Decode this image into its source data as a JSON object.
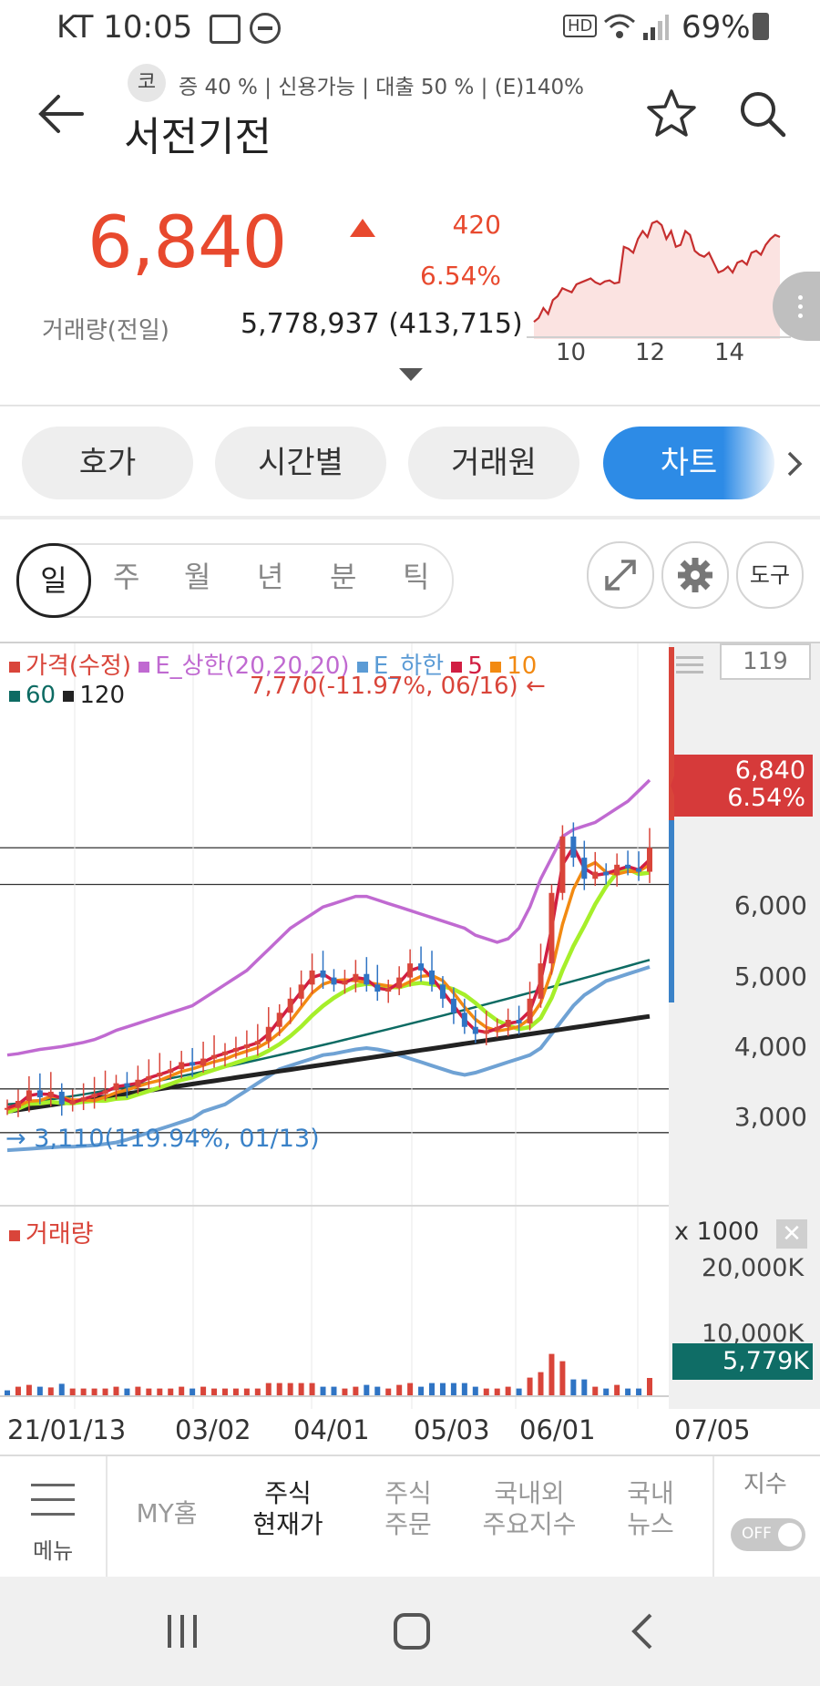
{
  "status": {
    "carrier_time": "KT 10:05",
    "battery": "69%"
  },
  "header": {
    "badge": "코",
    "info_line": "증 40 % | 신용가능 | 대출 50 % | (E)140%",
    "title": "서전기전"
  },
  "quote": {
    "price": "6,840",
    "change": "420",
    "change_pct": "6.54%",
    "volume_label": "거래량(전일)",
    "volume_value": "5,778,937 (413,715)",
    "mini_ticks": [
      "10",
      "12",
      "14"
    ],
    "mini_series": [
      20,
      24,
      34,
      28,
      42,
      46,
      54,
      52,
      50,
      58,
      60,
      62,
      64,
      60,
      58,
      61,
      62,
      59,
      60,
      96,
      94,
      90,
      104,
      112,
      106,
      120,
      122,
      118,
      104,
      112,
      96,
      98,
      112,
      108,
      92,
      88,
      86,
      90,
      80,
      70,
      72,
      76,
      70,
      80,
      82,
      78,
      90,
      92,
      88,
      98,
      104,
      108,
      106
    ],
    "up_color": "#e8492e"
  },
  "tabs": [
    "호가",
    "시간별",
    "거래원",
    "차트"
  ],
  "active_tab": "차트",
  "periods": [
    "일",
    "주",
    "월",
    "년",
    "분",
    "틱"
  ],
  "active_period": "일",
  "tools": {
    "expand_icon": "expand-arrows-icon",
    "settings_icon": "gear-icon",
    "tool_label": "도구"
  },
  "chart": {
    "legend_row1": [
      {
        "label": "가격(수정)",
        "color": "#d9453a"
      },
      {
        "label": "E_상한(20,20,20)",
        "color": "#c06ad1"
      },
      {
        "label": "E_하한",
        "color": "#5b9bd5"
      },
      {
        "label": "5",
        "color": "#d11e42"
      },
      {
        "label": "10",
        "color": "#f28a12"
      }
    ],
    "legend_row2": [
      {
        "label": "60",
        "color": "#0d6b63"
      },
      {
        "label": "120",
        "color": "#222222"
      }
    ],
    "high_note": "7,770(-11.97%, 06/16) ←",
    "low_note": "→ 3,110(119.94%, 01/13)",
    "period_count": "119",
    "price_tag": "6,840",
    "price_tag_pct": "6.54%",
    "volume_title": "거래량",
    "volume_scale": "x 1000",
    "volume_tag": "5,779K",
    "volume_axis": [
      "20,000K",
      "10,000K"
    ],
    "x_labels": [
      "21/01/13",
      "03/02",
      "04/01",
      "05/03",
      "06/01",
      "07/05"
    ]
  },
  "chart_data": {
    "type": "line",
    "x_labels": [
      "21/01/13",
      "03/02",
      "04/01",
      "05/03",
      "06/01",
      "07/05"
    ],
    "y_ticks": [
      3000,
      4000,
      5000,
      6000
    ],
    "ylim": [
      2500,
      8000
    ],
    "series": [
      {
        "name": "가격(수정)",
        "color": "#d9453a",
        "values": [
          3150,
          3250,
          3400,
          3300,
          3380,
          3200,
          3250,
          3300,
          3350,
          3400,
          3500,
          3450,
          3550,
          3600,
          3650,
          3700,
          3800,
          3750,
          3850,
          3900,
          3950,
          4000,
          4050,
          4100,
          4300,
          4500,
          4700,
          4900,
          5100,
          5000,
          4900,
          4950,
          5050,
          4900,
          4800,
          4850,
          5000,
          5200,
          5100,
          4900,
          4700,
          4500,
          4300,
          4200,
          4250,
          4300,
          4400,
          4350,
          4700,
          5200,
          6200,
          7000,
          6700,
          6400,
          6500,
          6450,
          6600,
          6550,
          6500,
          6840
        ]
      },
      {
        "name": "E_상한(20,20,20)",
        "color": "#c06ad1",
        "values": [
          3900,
          3920,
          3950,
          3980,
          4000,
          4020,
          4050,
          4080,
          4120,
          4180,
          4250,
          4300,
          4350,
          4400,
          4450,
          4500,
          4550,
          4600,
          4700,
          4800,
          4900,
          5000,
          5100,
          5250,
          5400,
          5550,
          5700,
          5800,
          5900,
          6000,
          6050,
          6100,
          6150,
          6150,
          6100,
          6050,
          6000,
          5950,
          5900,
          5850,
          5800,
          5750,
          5700,
          5600,
          5550,
          5500,
          5550,
          5700,
          6000,
          6400,
          6700,
          7000,
          7100,
          7150,
          7200,
          7300,
          7400,
          7500,
          7650,
          7800
        ]
      },
      {
        "name": "E_하한",
        "color": "#5b9bd5",
        "values": [
          2550,
          2560,
          2570,
          2580,
          2590,
          2600,
          2600,
          2610,
          2620,
          2640,
          2660,
          2700,
          2750,
          2800,
          2850,
          2900,
          2950,
          3000,
          3100,
          3150,
          3200,
          3300,
          3400,
          3500,
          3600,
          3700,
          3750,
          3800,
          3850,
          3900,
          3920,
          3950,
          3980,
          4000,
          3980,
          3950,
          3900,
          3850,
          3800,
          3750,
          3700,
          3650,
          3620,
          3650,
          3700,
          3750,
          3800,
          3850,
          3900,
          4000,
          4200,
          4400,
          4600,
          4750,
          4850,
          4950,
          5000,
          5050,
          5100,
          5150
        ]
      }
    ]
  },
  "bottom_nav": {
    "menu_label": "메뉴",
    "items": [
      {
        "label": "MY홈"
      },
      {
        "label": "주식\n현재가",
        "active": true
      },
      {
        "label": "주식\n주문"
      },
      {
        "label": "국내외\n주요지수"
      },
      {
        "label": "국내\n뉴스"
      }
    ],
    "index_label": "지수",
    "toggle_label": "OFF"
  }
}
